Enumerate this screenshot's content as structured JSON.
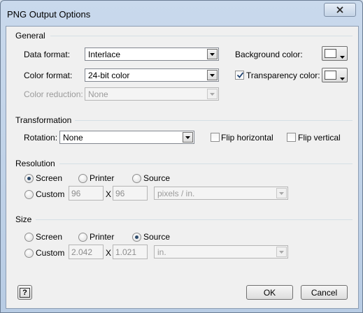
{
  "window": {
    "title": "PNG Output Options"
  },
  "general": {
    "title": "General",
    "data_format_label": "Data format:",
    "data_format_value": "Interlace",
    "color_format_label": "Color format:",
    "color_format_value": "24-bit color",
    "color_reduction_label": "Color reduction:",
    "color_reduction_value": "None",
    "background_color_label": "Background color:",
    "background_color_value": "#ffffff",
    "transparency_label": "Transparency color:",
    "transparency_checked": true,
    "transparency_color_value": "#ffffff"
  },
  "transformation": {
    "title": "Transformation",
    "rotation_label": "Rotation:",
    "rotation_value": "None",
    "flip_horizontal_label": "Flip horizontal",
    "flip_horizontal_checked": false,
    "flip_vertical_label": "Flip vertical",
    "flip_vertical_checked": false
  },
  "resolution": {
    "title": "Resolution",
    "screen_label": "Screen",
    "printer_label": "Printer",
    "source_label": "Source",
    "custom_label": "Custom",
    "selected": "Screen",
    "width_value": "96",
    "x_label": "X",
    "height_value": "96",
    "units_value": "pixels / in."
  },
  "size": {
    "title": "Size",
    "screen_label": "Screen",
    "printer_label": "Printer",
    "source_label": "Source",
    "custom_label": "Custom",
    "selected": "Source",
    "width_value": "2.042",
    "x_label": "X",
    "height_value": "1.021",
    "units_value": "in."
  },
  "buttons": {
    "help_label": "?",
    "ok_label": "OK",
    "cancel_label": "Cancel"
  }
}
